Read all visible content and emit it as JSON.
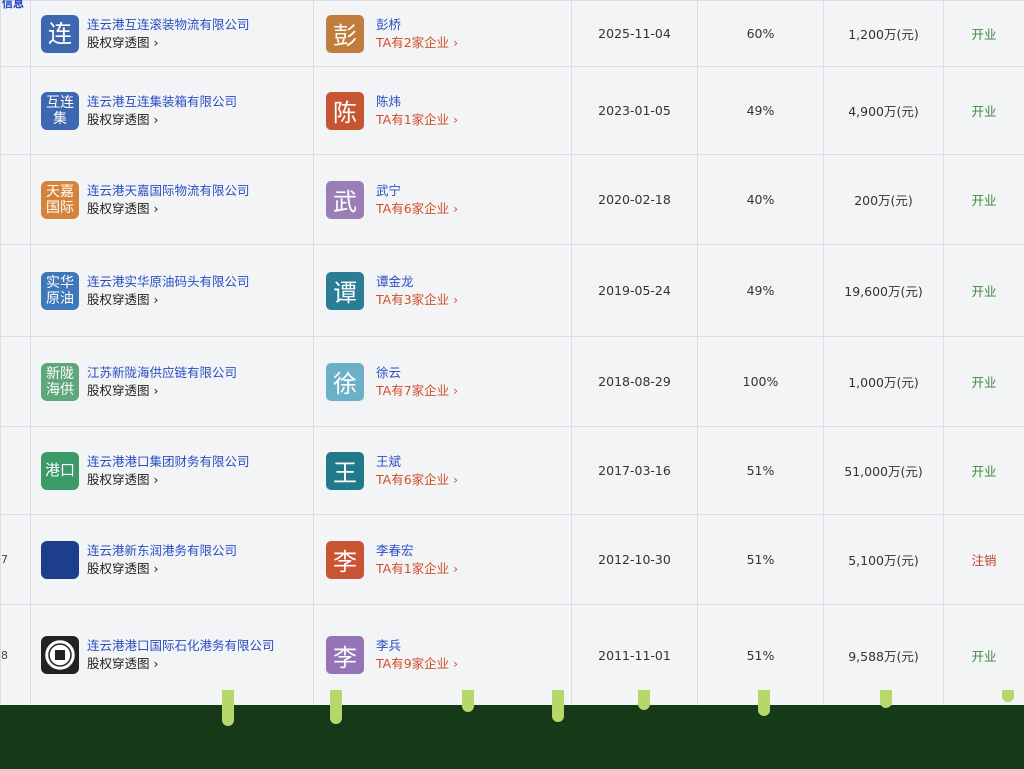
{
  "header_fragment": "信息",
  "rows": [
    {
      "index": "",
      "logo_text": "连",
      "logo_color": "#3e67b1",
      "company": "连云港互连滚装物流有限公司",
      "equity_link": "股权穿透图",
      "avatar_text": "彭",
      "avatar_color": "#c07d3c",
      "person": "彭桥",
      "count": "TA有2家企业",
      "date": "2025-11-04",
      "ratio": "60%",
      "capital": "1,200万(元)",
      "status": "开业",
      "status_kind": "open"
    },
    {
      "index": "",
      "logo_text": "互连集",
      "logo_color": "#3e67b1",
      "company": "连云港互连集装箱有限公司",
      "equity_link": "股权穿透图",
      "avatar_text": "陈",
      "avatar_color": "#c65632",
      "person": "陈炜",
      "count": "TA有1家企业",
      "date": "2023-01-05",
      "ratio": "49%",
      "capital": "4,900万(元)",
      "status": "开业",
      "status_kind": "open"
    },
    {
      "index": "",
      "logo_text": "天嘉国际",
      "logo_color": "#d5823b",
      "company": "连云港天嘉国际物流有限公司",
      "equity_link": "股权穿透图",
      "avatar_text": "武",
      "avatar_color": "#9b7eb6",
      "person": "武宁",
      "count": "TA有6家企业",
      "date": "2020-02-18",
      "ratio": "40%",
      "capital": "200万(元)",
      "status": "开业",
      "status_kind": "open"
    },
    {
      "index": "",
      "logo_text": "实华原油",
      "logo_color": "#3f78b8",
      "company": "连云港实华原油码头有限公司",
      "equity_link": "股权穿透图",
      "avatar_text": "谭",
      "avatar_color": "#2b7d96",
      "person": "谭金龙",
      "count": "TA有3家企业",
      "date": "2019-05-24",
      "ratio": "49%",
      "capital": "19,600万(元)",
      "status": "开业",
      "status_kind": "open"
    },
    {
      "index": "",
      "logo_text": "新陇海供",
      "logo_color": "#5fa67a",
      "company": "江苏新陇海供应链有限公司",
      "equity_link": "股权穿透图",
      "avatar_text": "徐",
      "avatar_color": "#6cb0c8",
      "person": "徐云",
      "count": "TA有7家企业",
      "date": "2018-08-29",
      "ratio": "100%",
      "capital": "1,000万(元)",
      "status": "开业",
      "status_kind": "open"
    },
    {
      "index": "",
      "logo_text": "港口",
      "logo_color": "#3a9a68",
      "company": "连云港港口集团财务有限公司",
      "equity_link": "股权穿透图",
      "avatar_text": "王",
      "avatar_color": "#217a8a",
      "person": "王斌",
      "count": "TA有6家企业",
      "date": "2017-03-16",
      "ratio": "51%",
      "capital": "51,000万(元)",
      "status": "开业",
      "status_kind": "open"
    },
    {
      "index": "7",
      "logo_text": "",
      "logo_color": "#1d3e8a",
      "company": "连云港新东润港务有限公司",
      "equity_link": "股权穿透图",
      "avatar_text": "李",
      "avatar_color": "#c95434",
      "person": "李春宏",
      "count": "TA有1家企业",
      "date": "2012-10-30",
      "ratio": "51%",
      "capital": "5,100万(元)",
      "status": "注销",
      "status_kind": "closed"
    },
    {
      "index": "8",
      "logo_text": "",
      "logo_color": "#222222",
      "company": "连云港港口国际石化港务有限公司",
      "equity_link": "股权穿透图",
      "avatar_text": "李",
      "avatar_color": "#9473b6",
      "person": "李兵",
      "count": "TA有9家企业",
      "date": "2011-11-01",
      "ratio": "51%",
      "capital": "9,588万(元)",
      "status": "开业",
      "status_kind": "open"
    }
  ]
}
